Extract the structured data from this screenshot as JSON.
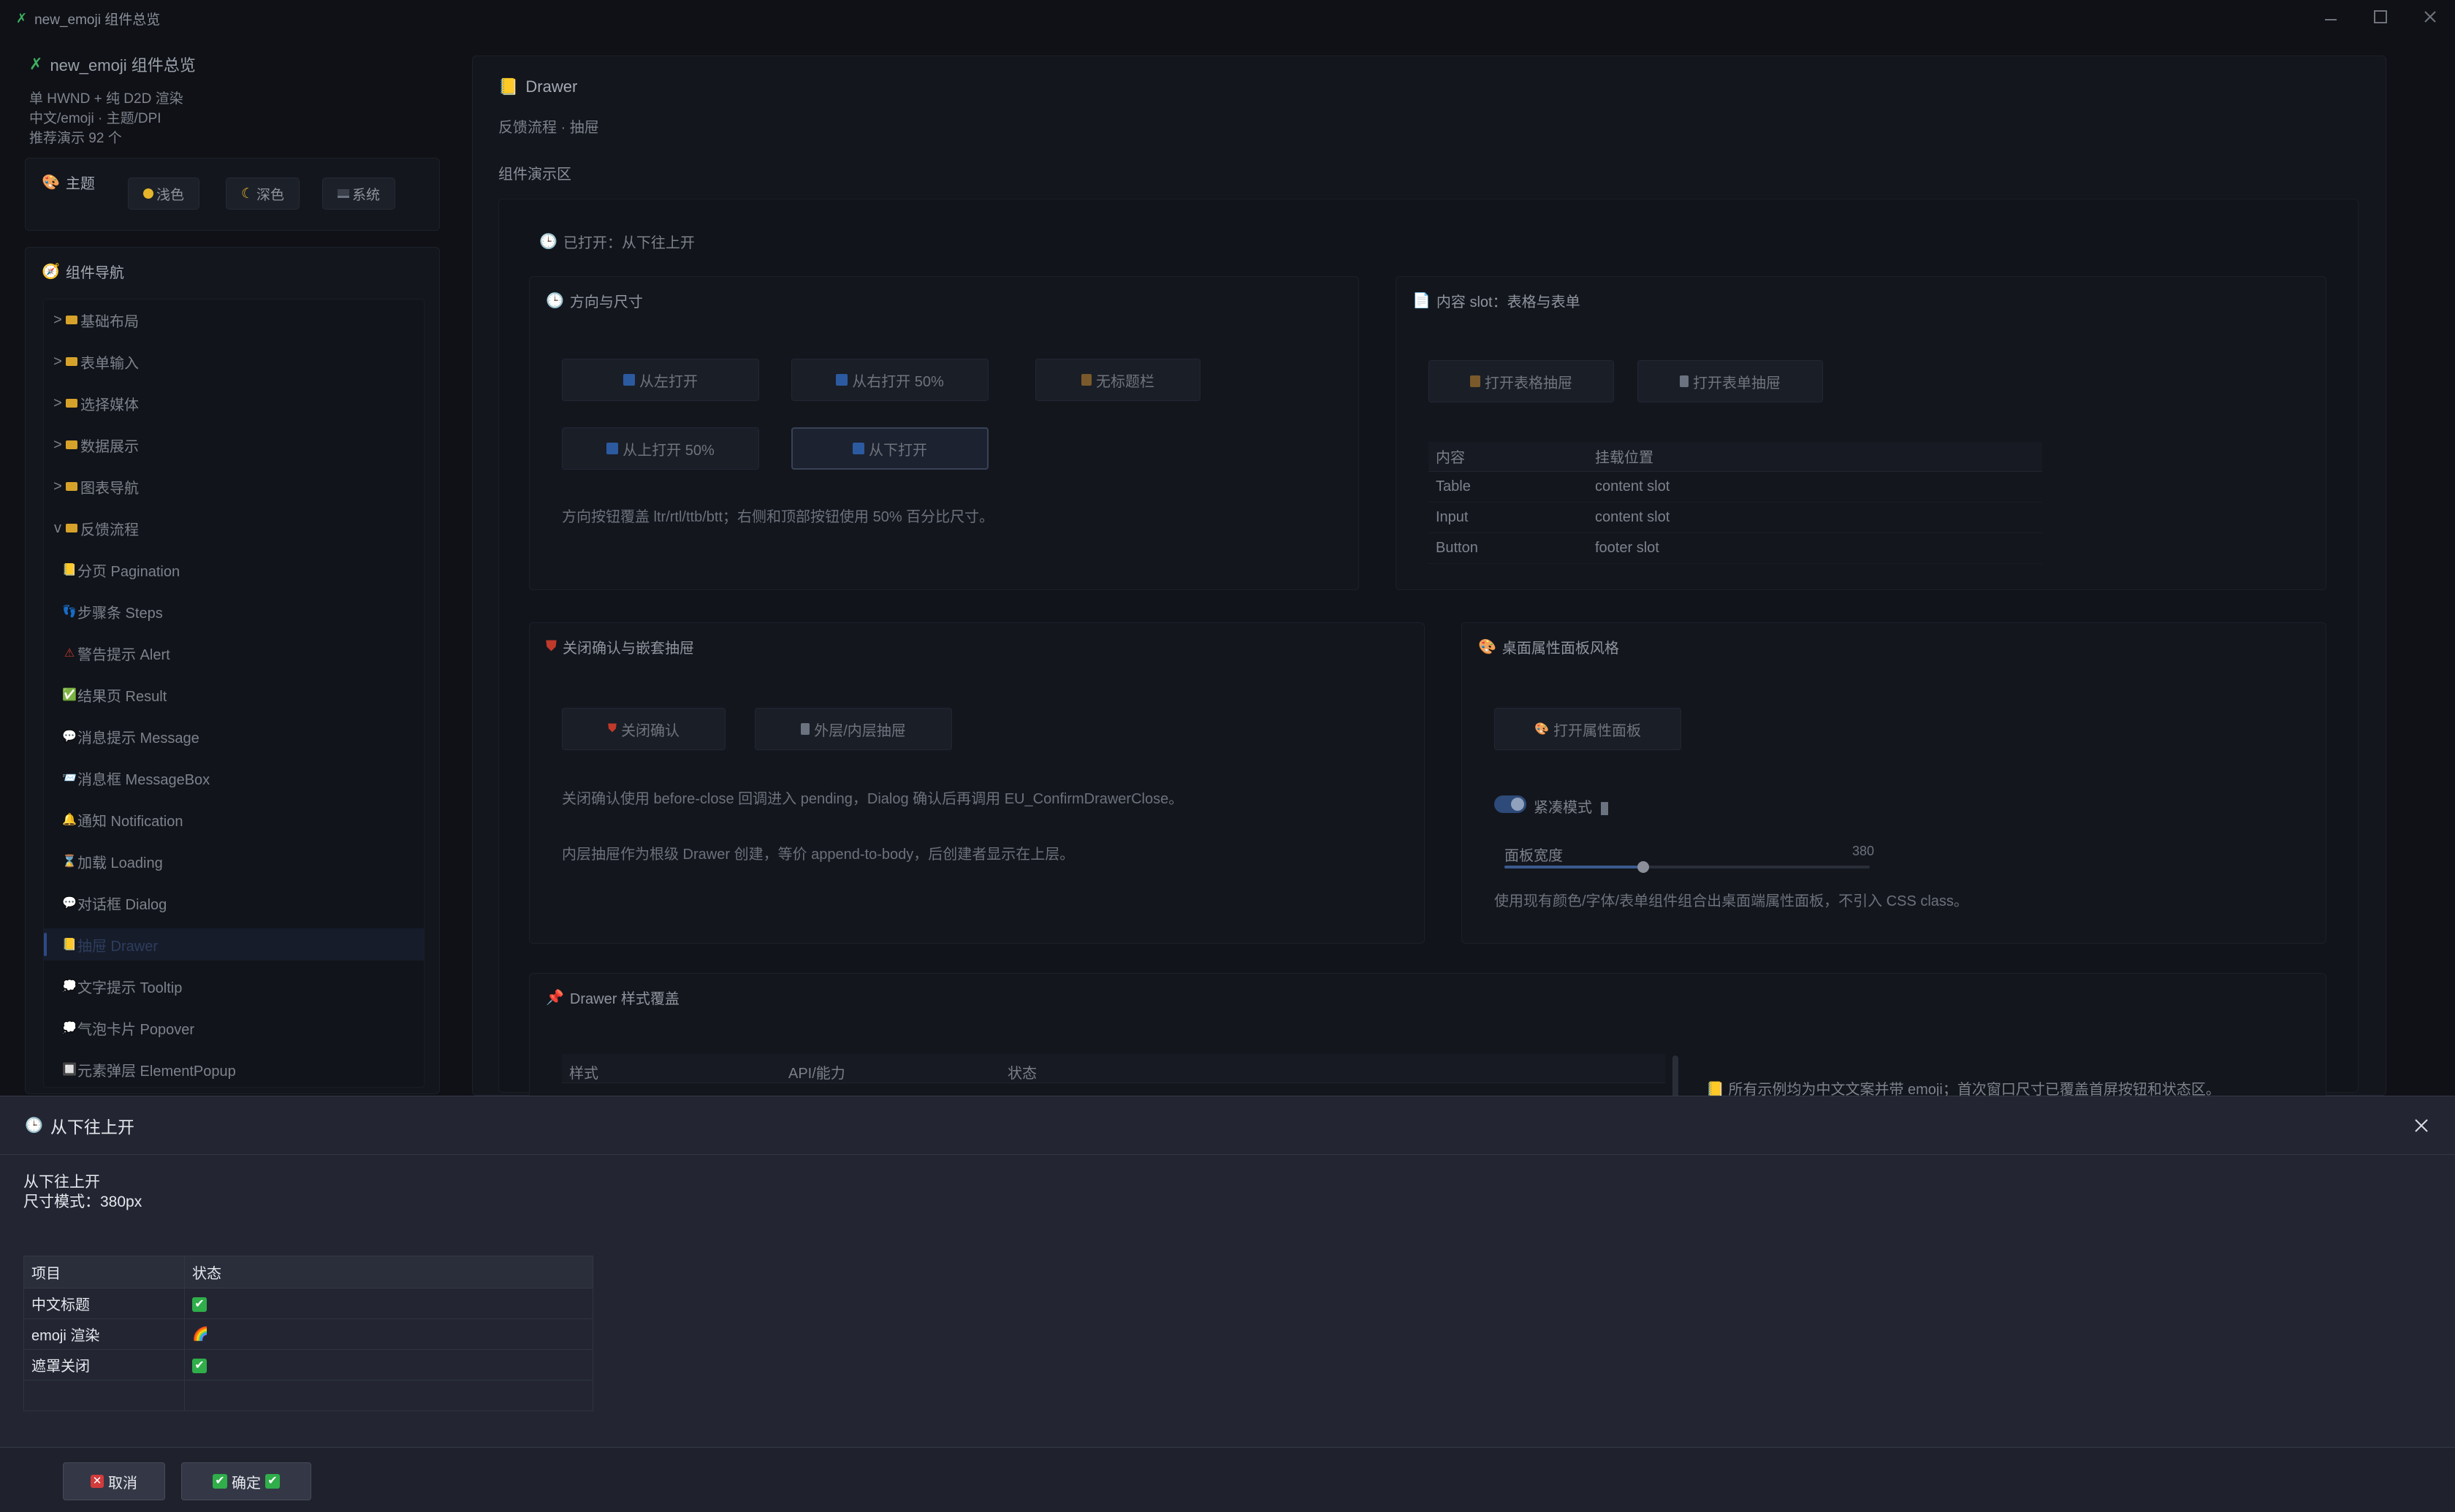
{
  "window": {
    "title": "new_emoji 组件总览"
  },
  "sidebar": {
    "title": "new_emoji 组件总览",
    "meta": [
      "单 HWND + 纯 D2D 渲染",
      "中文/emoji · 主题/DPI",
      "推荐演示 92 个"
    ],
    "theme": {
      "label": "主题",
      "buttons": [
        "浅色",
        "深色",
        "系统"
      ]
    },
    "nav": {
      "label": "组件导航",
      "groups": [
        {
          "caret": ">",
          "label": "基础布局"
        },
        {
          "caret": ">",
          "label": "表单输入"
        },
        {
          "caret": ">",
          "label": "选择媒体"
        },
        {
          "caret": ">",
          "label": "数据展示"
        },
        {
          "caret": ">",
          "label": "图表导航"
        },
        {
          "caret": "v",
          "label": "反馈流程"
        }
      ],
      "children": [
        {
          "icon": "📒",
          "label": "分页 Pagination"
        },
        {
          "icon": "👣",
          "label": "步骤条 Steps"
        },
        {
          "icon": "⚠",
          "label": "警告提示 Alert"
        },
        {
          "icon": "✅",
          "label": "结果页 Result"
        },
        {
          "icon": "💬",
          "label": "消息提示 Message"
        },
        {
          "icon": "📨",
          "label": "消息框 MessageBox"
        },
        {
          "icon": "🔔",
          "label": "通知 Notification"
        },
        {
          "icon": "⌛",
          "label": "加载 Loading"
        },
        {
          "icon": "💬",
          "label": "对话框 Dialog"
        },
        {
          "icon": "📒",
          "label": "抽屉 Drawer"
        },
        {
          "icon": "💭",
          "label": "文字提示 Tooltip"
        },
        {
          "icon": "💭",
          "label": "气泡卡片 Popover"
        },
        {
          "icon": "🔲",
          "label": "元素弹层 ElementPopup"
        }
      ],
      "active": "抽屉 Drawer"
    }
  },
  "main": {
    "title": "Drawer",
    "subtitle": "反馈流程 · 抽屉",
    "demo_label": "组件演示区",
    "opened_status": "已打开：从下往上开",
    "direction_panel": {
      "title": "方向与尺寸",
      "buttons": [
        "从左打开",
        "从右打开 50%",
        "无标题栏",
        "从上打开 50%",
        "从下打开"
      ],
      "selected": "从下打开",
      "note": "方向按钮覆盖 ltr/rtl/ttb/btt；右侧和顶部按钮使用 50% 百分比尺寸。"
    },
    "slot_panel": {
      "title": "内容 slot：表格与表单",
      "buttons": [
        "打开表格抽屉",
        "打开表单抽屉"
      ],
      "table": {
        "headers": [
          "内容",
          "挂载位置"
        ],
        "rows": [
          [
            "Table",
            "content slot"
          ],
          [
            "Input",
            "content slot"
          ],
          [
            "Button",
            "footer slot"
          ]
        ]
      }
    },
    "close_panel": {
      "title": "关闭确认与嵌套抽屉",
      "buttons": [
        "关闭确认",
        "外层/内层抽屉"
      ],
      "note1": "关闭确认使用 before-close 回调进入 pending，Dialog 确认后再调用 EU_ConfirmDrawerClose。",
      "note2": "内层抽屉作为根级 Drawer 创建，等价 append-to-body，后创建者显示在上层。"
    },
    "desktop_panel": {
      "title": "桌面属性面板风格",
      "button": "打开属性面板",
      "toggle_label": "紧凑模式",
      "toggle_on": true,
      "slider_label": "面板宽度",
      "slider_value": "380",
      "slider_fraction": 0.38,
      "note": "使用现有颜色/字体/表单组件组合出桌面端属性面板，不引入 CSS class。"
    },
    "style_panel": {
      "title": "Drawer 样式覆盖",
      "headers": [
        "样式",
        "API/能力",
        "状态"
      ],
      "side_note": "所有示例均为中文文案并带 emoji；首次窗口尺寸已覆盖首屏按钮和状态区。"
    }
  },
  "drawer": {
    "title": "从下往上开",
    "body_line1": "从下往上开",
    "body_line2": "尺寸模式：380px",
    "table": {
      "headers": [
        "项目",
        "状态"
      ],
      "rows": [
        {
          "item": "中文标题",
          "status": "✔"
        },
        {
          "item": "emoji 渲染",
          "status": "🌈"
        },
        {
          "item": "遮罩关闭",
          "status": "✔"
        }
      ]
    },
    "cancel_label": "取消",
    "confirm_label": "确定"
  }
}
